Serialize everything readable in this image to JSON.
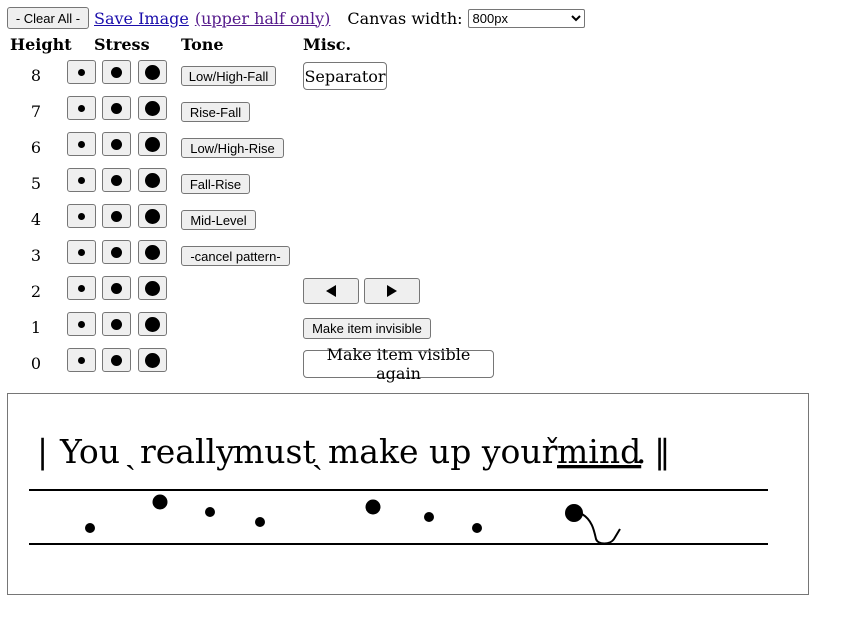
{
  "toolbar": {
    "clear_all_label": "- Clear All -",
    "save_image_label": "Save Image",
    "upper_half_label": "(upper half only)",
    "canvas_width_label": "Canvas width:",
    "canvas_width_value": "800px"
  },
  "columns": {
    "height": "Height",
    "stress": "Stress",
    "tone": "Tone",
    "misc": "Misc."
  },
  "rows": [
    {
      "height": "8"
    },
    {
      "height": "7"
    },
    {
      "height": "6"
    },
    {
      "height": "5"
    },
    {
      "height": "4"
    },
    {
      "height": "3"
    },
    {
      "height": "2"
    },
    {
      "height": "1"
    },
    {
      "height": "0"
    }
  ],
  "tone_buttons": [
    "Low/High-Fall",
    "Rise-Fall",
    "Low/High-Rise",
    "Fall-Rise",
    "Mid-Level",
    "-cancel pattern-"
  ],
  "misc": {
    "separator_label": "Separator",
    "arrow_left_icon": "triangle-left",
    "arrow_right_icon": "triangle-right",
    "make_invisible_label": "Make item invisible",
    "make_visible_label": "Make item visible again"
  },
  "canvas": {
    "bar_start": "|",
    "word1": "You",
    "word2_mark": "ˎ",
    "word2": "really",
    "word3": "must",
    "word4_mark": "ˎ",
    "word4": "make up your",
    "word5_mark": "ˇ",
    "word5": "mind",
    "period": ".",
    "bar_end": "‖"
  }
}
